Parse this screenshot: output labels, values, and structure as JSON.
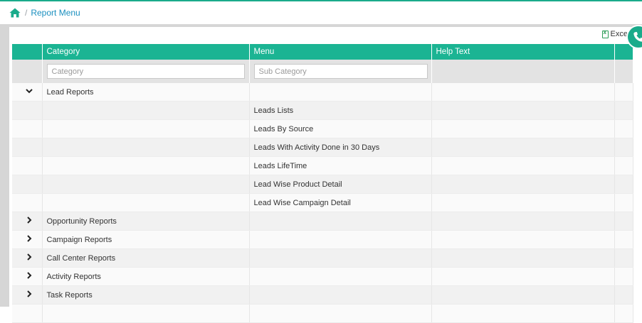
{
  "breadcrumb": {
    "home_icon": "home-icon",
    "separator": "/",
    "current": "Report Menu"
  },
  "toolbar": {
    "excel_label": "Exce",
    "excel_icon": "excel-file-icon"
  },
  "fab": {
    "icon": "phone-icon"
  },
  "colors": {
    "accent": "#1bb493",
    "link": "#1a8fbf"
  },
  "table": {
    "columns": [
      "Category",
      "Menu",
      "Help Text"
    ],
    "filters": {
      "category_placeholder": "Category",
      "menu_placeholder": "Sub Category"
    },
    "rows": [
      {
        "toggle": "expanded",
        "category": "Lead Reports",
        "menu": "",
        "help": ""
      },
      {
        "toggle": "",
        "category": "",
        "menu": "Leads Lists",
        "help": ""
      },
      {
        "toggle": "",
        "category": "",
        "menu": "Leads By Source",
        "help": ""
      },
      {
        "toggle": "",
        "category": "",
        "menu": "Leads With Activity Done in 30 Days",
        "help": ""
      },
      {
        "toggle": "",
        "category": "",
        "menu": "Leads LifeTime",
        "help": ""
      },
      {
        "toggle": "",
        "category": "",
        "menu": "Lead Wise Product Detail",
        "help": ""
      },
      {
        "toggle": "",
        "category": "",
        "menu": "Lead Wise Campaign Detail",
        "help": ""
      },
      {
        "toggle": "collapsed",
        "category": "Opportunity Reports",
        "menu": "",
        "help": ""
      },
      {
        "toggle": "collapsed",
        "category": "Campaign Reports",
        "menu": "",
        "help": ""
      },
      {
        "toggle": "collapsed",
        "category": "Call Center Reports",
        "menu": "",
        "help": ""
      },
      {
        "toggle": "collapsed",
        "category": "Activity Reports",
        "menu": "",
        "help": ""
      },
      {
        "toggle": "collapsed",
        "category": "Task Reports",
        "menu": "",
        "help": ""
      },
      {
        "toggle": "",
        "category": "",
        "menu": "",
        "help": ""
      }
    ]
  }
}
